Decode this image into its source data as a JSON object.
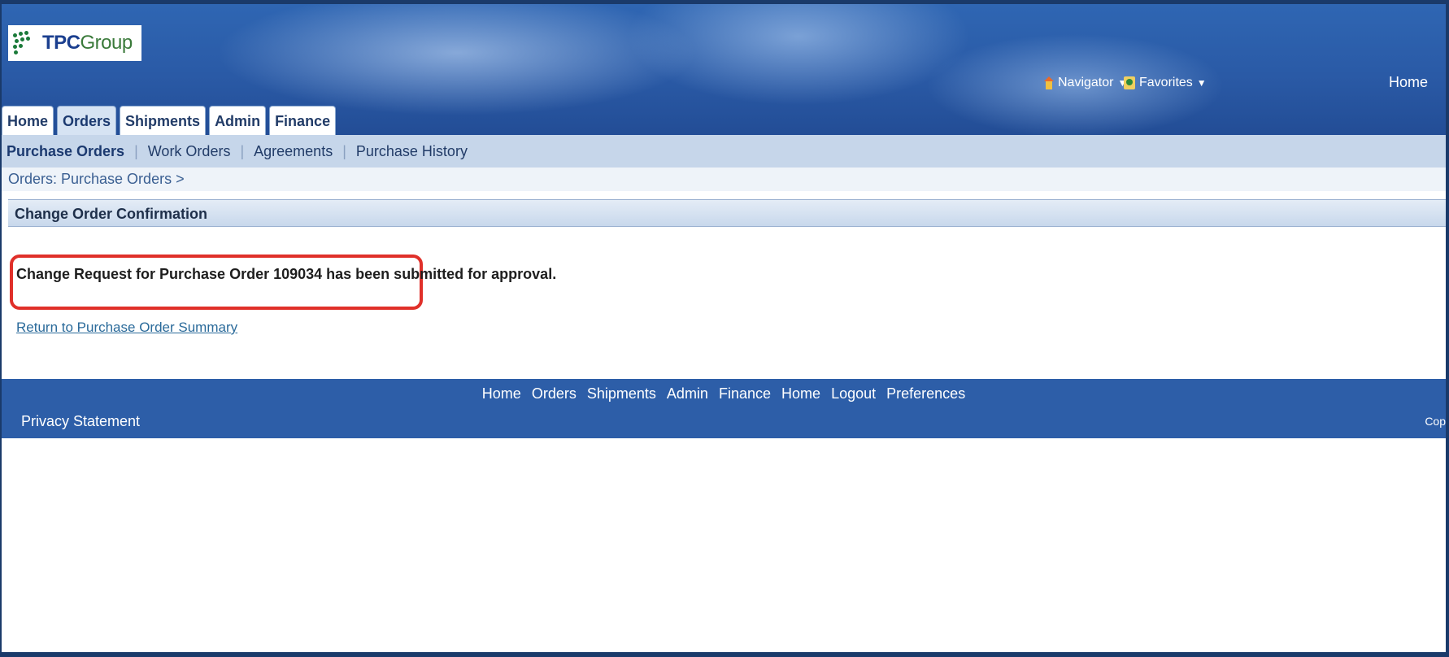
{
  "logo": {
    "brand_bold": "TPC",
    "brand_light": "Group"
  },
  "global": {
    "navigator": "Navigator",
    "favorites": "Favorites",
    "home": "Home",
    "icons": {
      "navigator": "house-icon",
      "favorites": "favorites-icon"
    }
  },
  "tabs": [
    {
      "label": "Home"
    },
    {
      "label": "Orders",
      "active": true
    },
    {
      "label": "Shipments"
    },
    {
      "label": "Admin"
    },
    {
      "label": "Finance"
    }
  ],
  "subnav": [
    {
      "label": "Purchase Orders",
      "active": true
    },
    {
      "label": "Work Orders"
    },
    {
      "label": "Agreements"
    },
    {
      "label": "Purchase History"
    }
  ],
  "breadcrumb": "Orders: Purchase Orders >",
  "section_title": "Change Order Confirmation",
  "message": "Change Request for Purchase Order 109034 has been submitted for approval.",
  "return_link": "Return to Purchase Order Summary",
  "footer": {
    "links": [
      "Home",
      "Orders",
      "Shipments",
      "Admin",
      "Finance",
      "Home",
      "Logout",
      "Preferences"
    ],
    "privacy": "Privacy Statement",
    "copyright_fragment": "Cop"
  },
  "colors": {
    "highlight_border": "#e0302a",
    "banner": "#2a5aa6",
    "footer": "#2d5ea8",
    "subnav": "#c6d6ea"
  }
}
